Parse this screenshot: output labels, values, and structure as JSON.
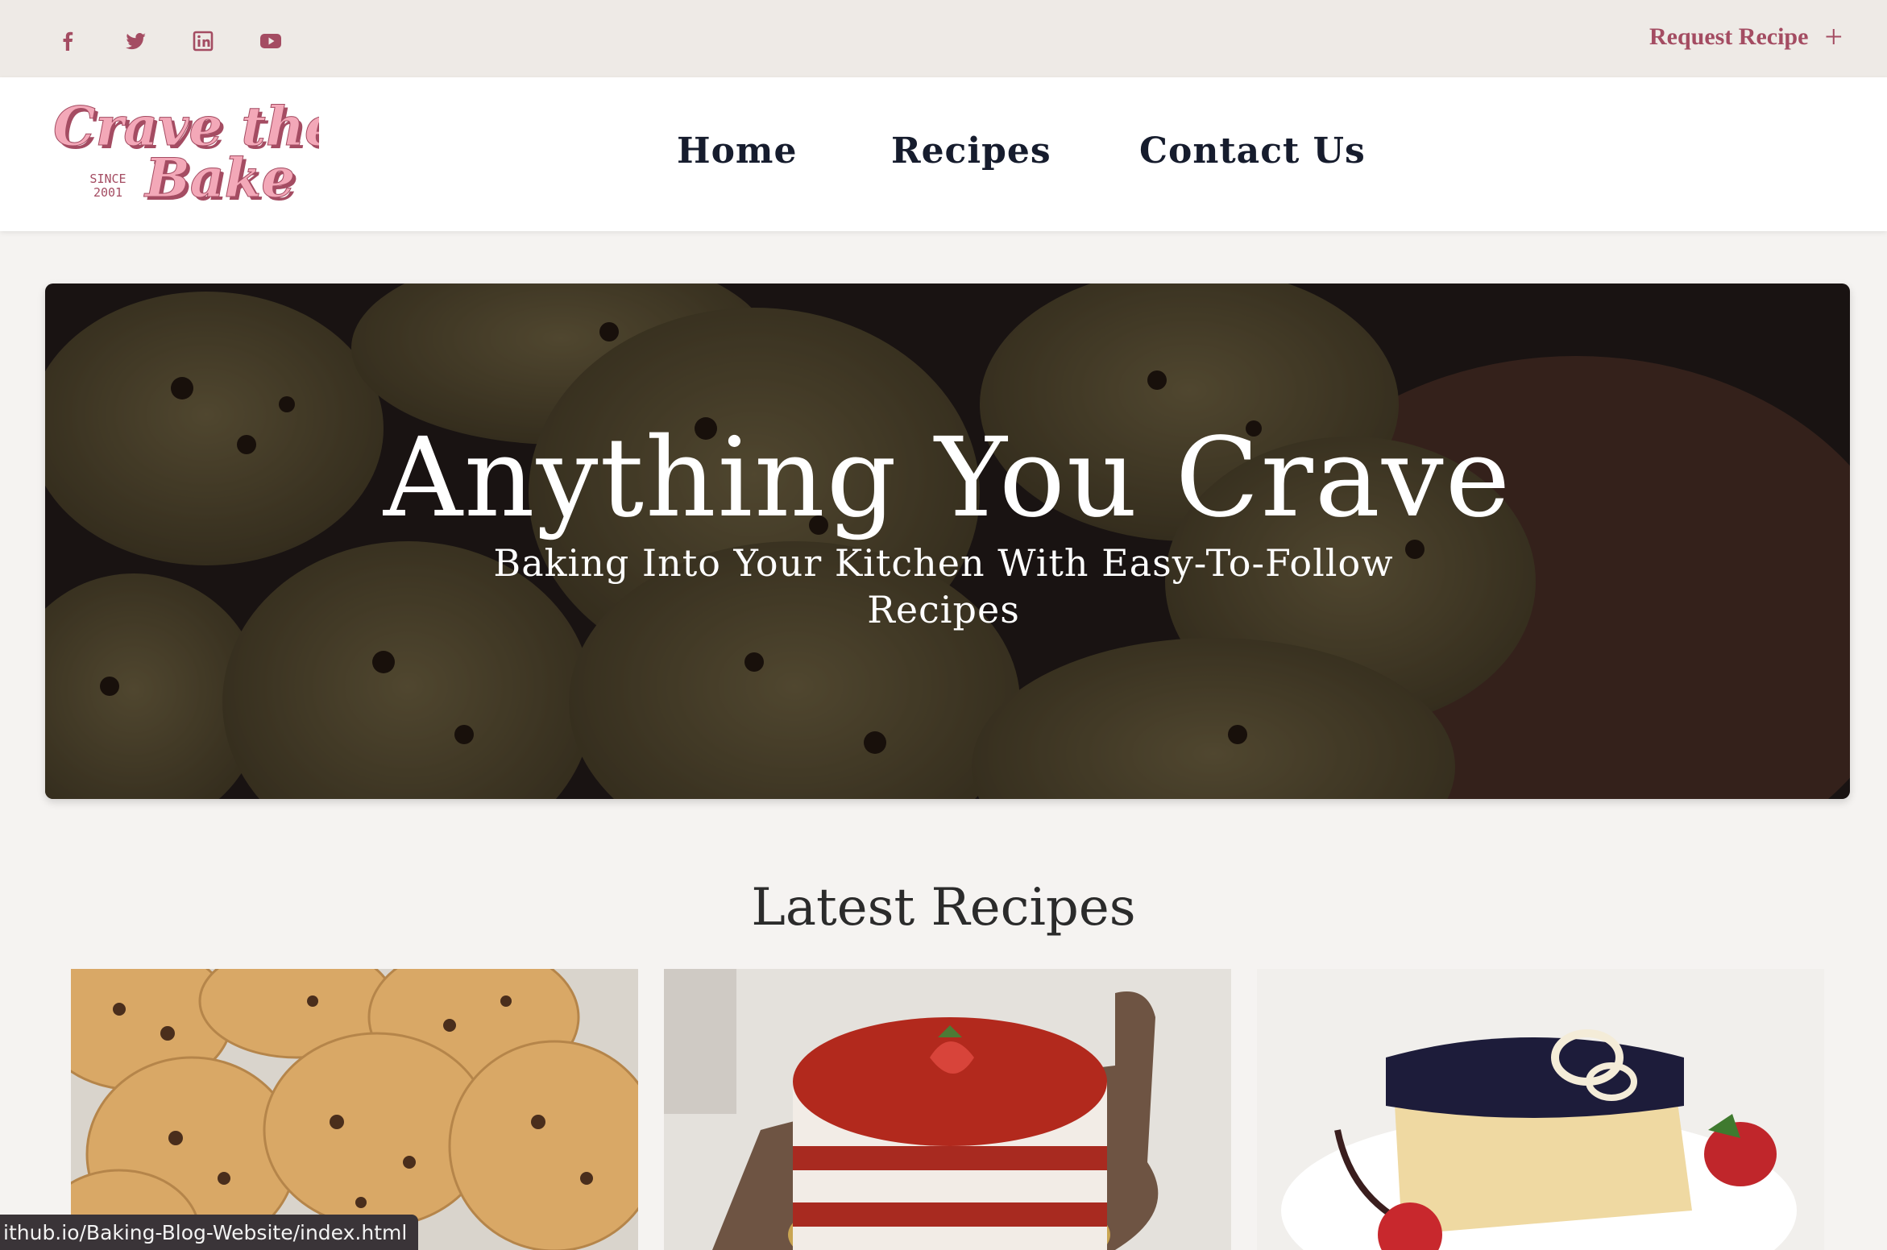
{
  "topbar": {
    "social_icons": [
      "facebook-icon",
      "twitter-icon",
      "linkedin-icon",
      "youtube-icon"
    ],
    "request_label": "Request Recipe",
    "request_icon": "plus-icon"
  },
  "logo": {
    "line1": "Crave the",
    "line2": "Bake",
    "since": "SINCE",
    "year": "2001"
  },
  "nav": {
    "items": [
      {
        "label": "Home"
      },
      {
        "label": "Recipes"
      },
      {
        "label": "Contact Us"
      }
    ]
  },
  "hero": {
    "title": "Anything You Crave",
    "subtitle": "Baking Into Your Kitchen With Easy-To-Follow Recipes"
  },
  "latest": {
    "title": "Latest Recipes"
  },
  "status_bar": {
    "url": "ithub.io/Baking-Blog-Website/index.html"
  },
  "colors": {
    "accent": "#a44c62",
    "nav_text": "#161c2d",
    "logo_pink": "#f0a3b3",
    "background": "#f5f3f1",
    "topbar": "#eeeae6"
  }
}
